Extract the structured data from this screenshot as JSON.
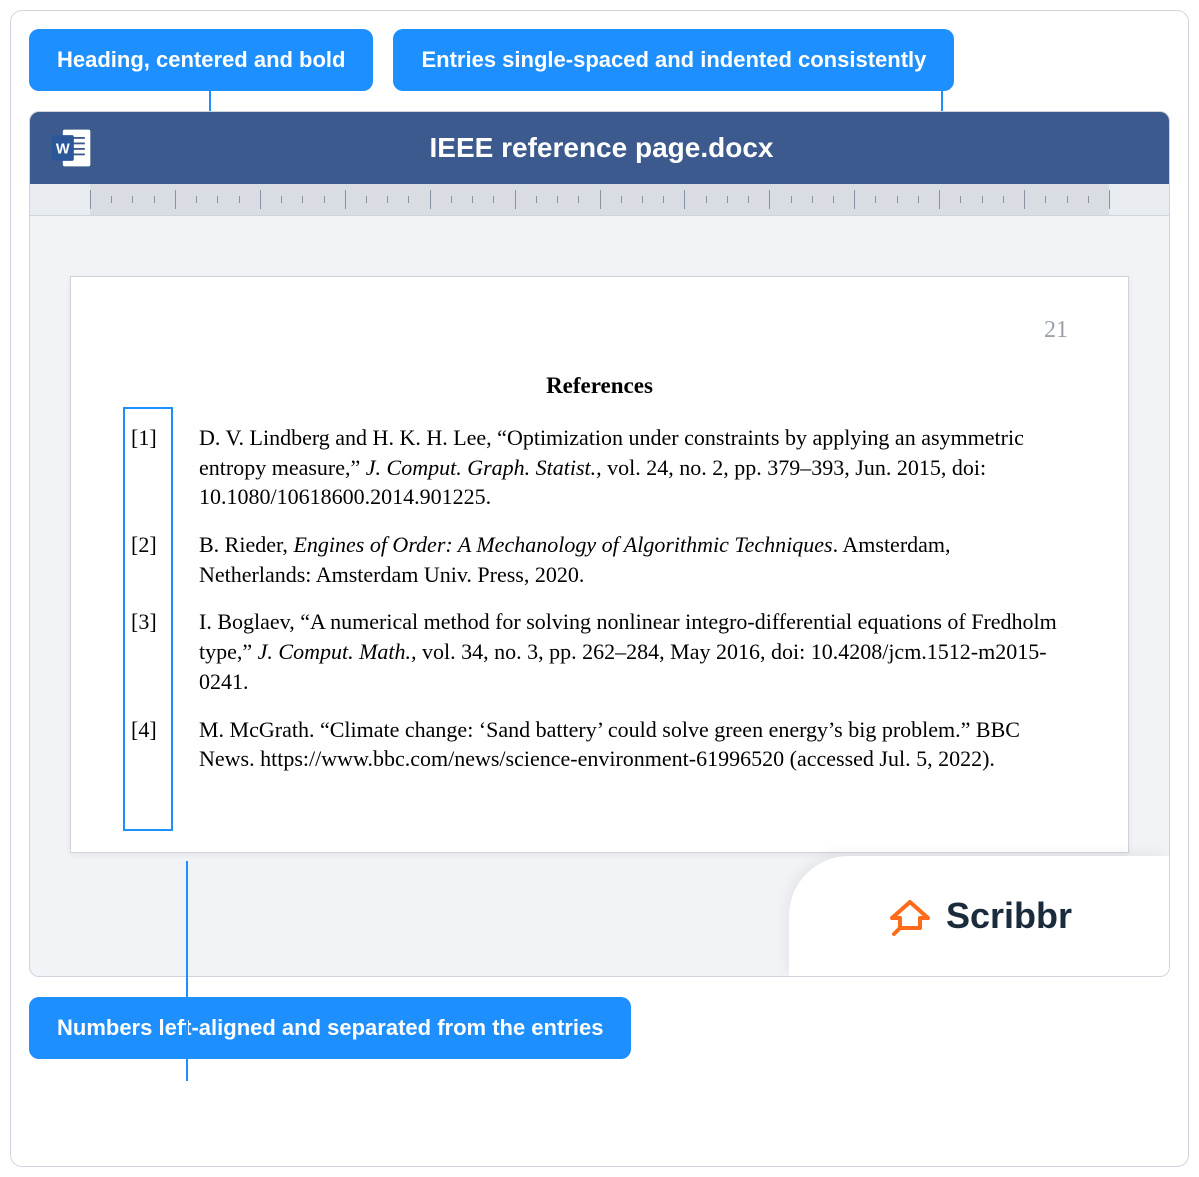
{
  "annotations": {
    "heading": "Heading, centered and bold",
    "entries": "Entries single-spaced and indented consistently",
    "numbers": "Numbers left-aligned and separated from the entries"
  },
  "doc": {
    "filename": "IEEE reference page.docx",
    "page_number": "21",
    "heading": "References",
    "references": [
      {
        "num": "[1]",
        "pre": "D. V. Lindberg and H. K. H. Lee, “Optimization under constraints by applying an asymmetric entropy measure,” ",
        "ital": "J. Comput. Graph. Statist.,",
        "post": " vol. 24, no. 2, pp. 379–393, Jun. 2015, doi: 10.1080/10618600.2014.901225."
      },
      {
        "num": "[2]",
        "pre": "B. Rieder, ",
        "ital": "Engines of Order: A Mechanology of Algorithmic Techniques",
        "post": ". Amsterdam, Netherlands: Amsterdam Univ. Press, 2020."
      },
      {
        "num": "[3]",
        "pre": "I. Boglaev, “A numerical method for solving nonlinear integro-differential equations of Fredholm type,” ",
        "ital": "J. Comput. Math.,",
        "post": " vol. 34, no. 3, pp. 262–284, May 2016, doi: 10.4208/jcm.1512-m2015-0241."
      },
      {
        "num": "[4]",
        "pre": "M. McGrath. “Climate change: ‘Sand battery’ could solve green energy’s big problem.” BBC News. https://www.bbc.com/news/science-environment-61996520 (accessed Jul. 5, 2022).",
        "ital": "",
        "post": ""
      }
    ]
  },
  "brand": {
    "name": "Scribbr"
  }
}
